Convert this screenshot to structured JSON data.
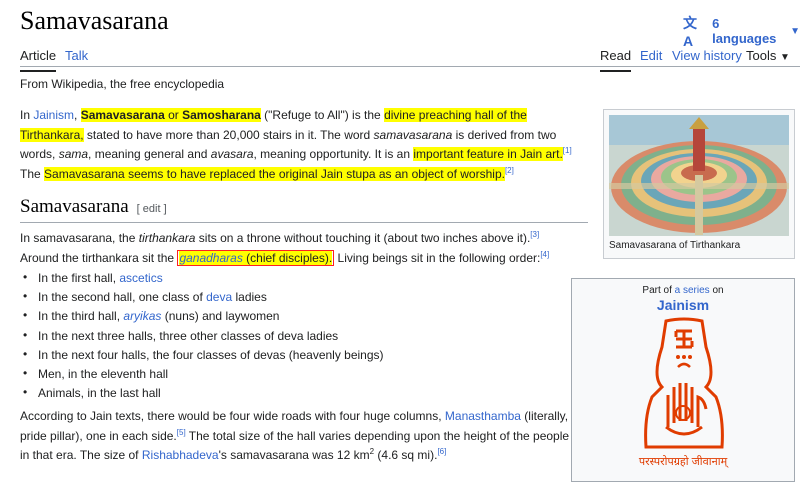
{
  "header": {
    "title": "Samavasarana",
    "language_button": "6 languages",
    "language_glyph": "文A"
  },
  "tabs": {
    "article": "Article",
    "talk": "Talk",
    "read": "Read",
    "edit": "Edit",
    "view_history": "View history",
    "tools": "Tools"
  },
  "tagline": "From Wikipedia, the free encyclopedia",
  "intro": {
    "in": "In ",
    "jainism_link": "Jainism",
    "comma": ", ",
    "term1": "Samavasarana",
    "or": " or ",
    "term2": "Samosharana",
    "refuge": " (\"Refuge to All\") is the ",
    "hl1": "divine preaching hall of the Tirthankara,",
    "rest1": " stated to have more than 20,000 stairs in it. The word ",
    "word_samavasarana": "samavasarana",
    "rest2": " is derived from two words, ",
    "word_sama": "sama",
    "rest3": ", meaning general and ",
    "word_avasara": "avasara",
    "rest4": ", meaning opportunity. It is an ",
    "hl2": "important feature in Jain art.",
    "ref1": "[1]",
    "rest5": " The ",
    "hl3": "Samavasarana seems to have replaced the original Jain stupa as an object of worship.",
    "ref2": "[2]"
  },
  "section": {
    "heading": "Samavasarana",
    "edit_link": "[ edit ]"
  },
  "para2": {
    "part1": "In samavasarana, the ",
    "tirthankara": "tirthankara",
    "part2": " sits on a throne without touching it (about two inches above it).",
    "ref3": "[3]",
    "part3": " Around the tirthankara sit the ",
    "ganadharas": "ganadharas",
    "chief": " (chief disciples).",
    "part4": " Living beings sit in the following order:",
    "ref4": "[4]"
  },
  "bullets": [
    {
      "pre": "In the first hall, ",
      "link": "ascetics",
      "post": ""
    },
    {
      "pre": "In the second hall, one class of ",
      "link": "deva",
      "post": " ladies"
    },
    {
      "pre": "In the third hall, ",
      "link": "aryikas",
      "post": " (nuns) and laywomen"
    },
    {
      "pre": "In the next three halls, three other classes of deva ladies",
      "link": "",
      "post": ""
    },
    {
      "pre": "In the next four halls, the four classes of devas (heavenly beings)",
      "link": "",
      "post": ""
    },
    {
      "pre": "Men, in the eleventh hall",
      "link": "",
      "post": ""
    },
    {
      "pre": "Animals, in the last hall",
      "link": "",
      "post": ""
    }
  ],
  "para3": {
    "part1": "According to Jain texts, there would be four wide roads with four huge columns, ",
    "manasthamba": "Manasthamba",
    "part2": " (literally, pride pillar), one in each side.",
    "ref5": "[5]",
    "part3": " The total size of the hall varies depending upon the height of the people in that era. The size of ",
    "rishabhadeva": "Rishabhadeva",
    "part4": "'s samavasarana was 12 km",
    "sup2": "2",
    "part5": " (4.6 sq mi).",
    "ref6": "[6]"
  },
  "figure": {
    "caption": "Samavasarana of Tirthankara"
  },
  "infobox": {
    "part_of": "Part of ",
    "a_series": "a series",
    "on": " on",
    "title": "Jainism",
    "motto": "परस्परोपग्रहो जीवानाम्"
  },
  "colors": {
    "link": "#3366cc",
    "highlight": "#ffff00",
    "annotation_box": "#ff2020",
    "emblem": "#e03c00"
  }
}
